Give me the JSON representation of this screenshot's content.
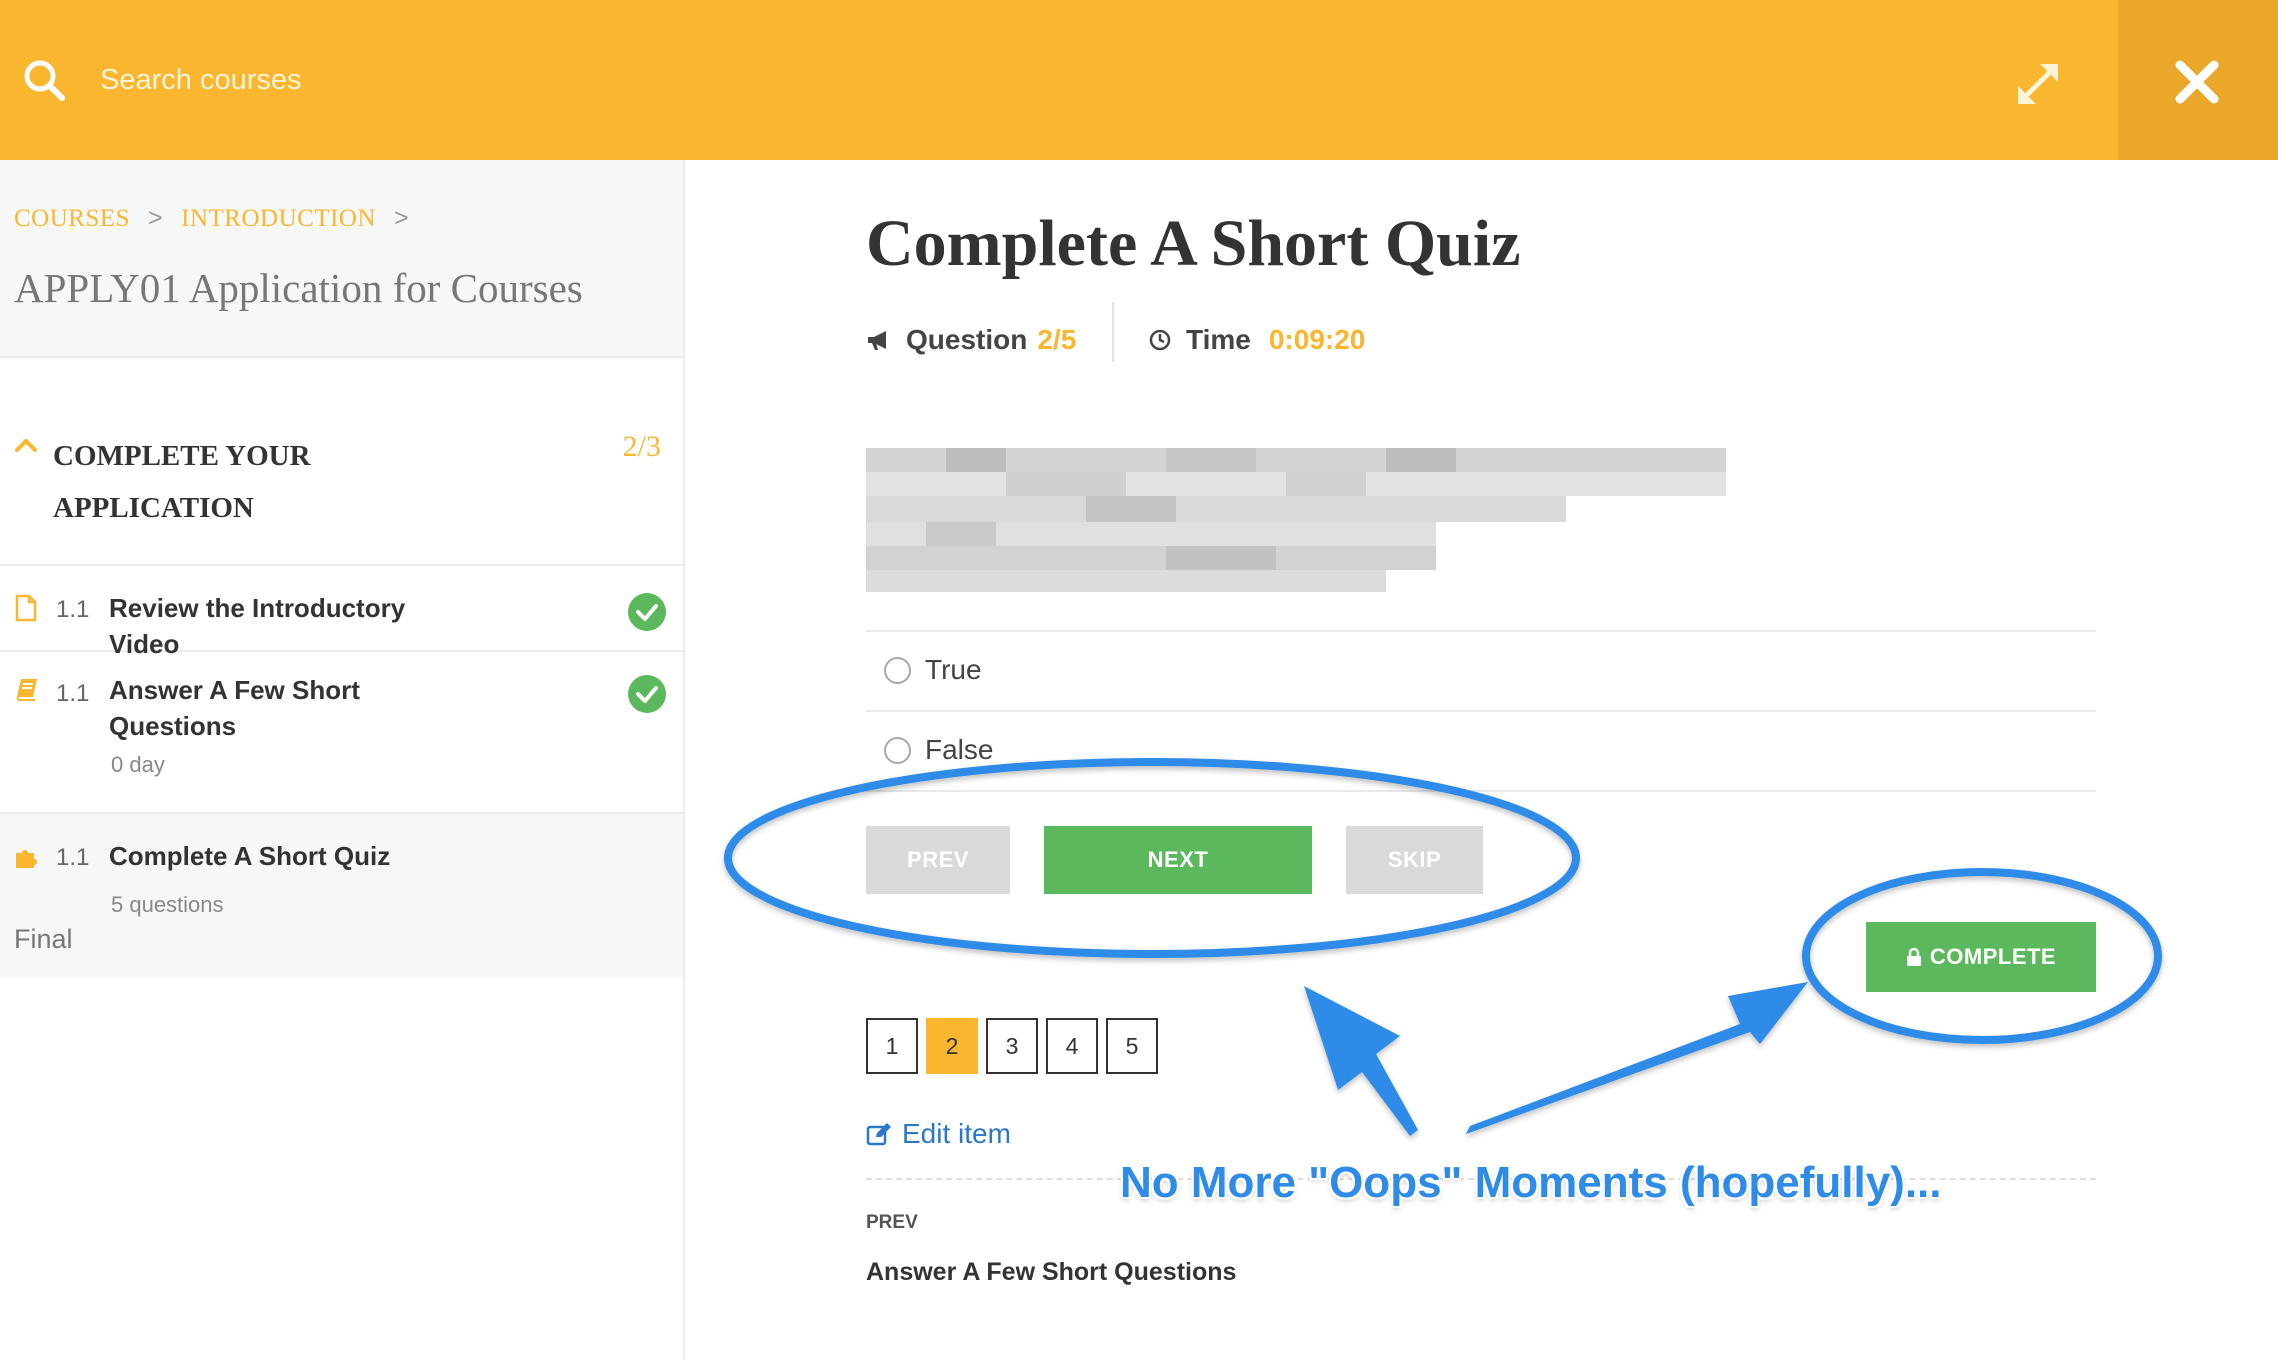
{
  "topbar": {
    "search_placeholder": "Search courses",
    "accent_color": "#fbb62f"
  },
  "sidebar": {
    "breadcrumbs": [
      "COURSES",
      "INTRODUCTION"
    ],
    "course_title": "APPLY01 Application for Courses",
    "section": {
      "title": "COMPLETE YOUR APPLICATION",
      "count": "2/3"
    },
    "lessons": [
      {
        "number": "1.1",
        "title": "Review the Introductory Video",
        "meta": "",
        "icon": "document-icon",
        "completed": true
      },
      {
        "number": "1.1",
        "title": "Answer A Few Short Questions",
        "meta": "0 day",
        "icon": "book-icon",
        "completed": true
      },
      {
        "number": "1.1",
        "title": "Complete A Short Quiz",
        "meta": "5 questions",
        "icon": "puzzle-icon",
        "completed": false
      }
    ],
    "final_label": "Final"
  },
  "quiz": {
    "title": "Complete A Short Quiz",
    "question_label": "Question",
    "question_value": "2/5",
    "time_label": "Time",
    "time_value": "0:09:20",
    "options": [
      "True",
      "False"
    ],
    "buttons": {
      "prev": "PREV",
      "next": "NEXT",
      "skip": "SKIP",
      "complete": "COMPLETE"
    },
    "pages": [
      "1",
      "2",
      "3",
      "4",
      "5"
    ],
    "current_page": 2,
    "edit_label": "Edit item",
    "prev_tag": "PREV",
    "prev_item": "Answer A Few Short Questions"
  },
  "annotation": {
    "text": "No More \"Oops\" Moments (hopefully)...",
    "color": "#2f8be8"
  }
}
